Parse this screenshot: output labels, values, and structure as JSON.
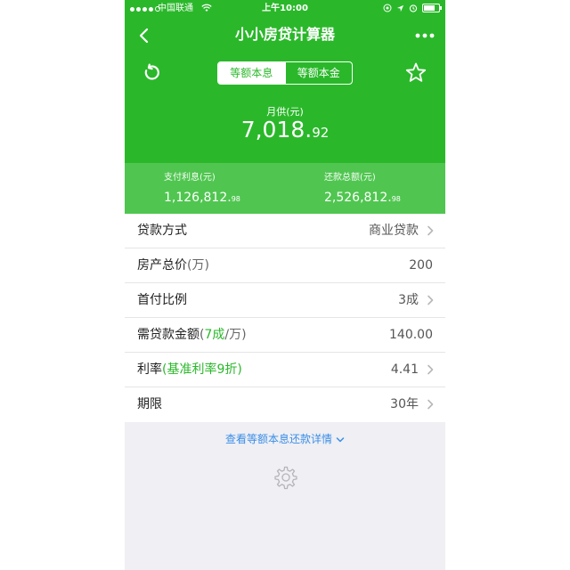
{
  "status_bar": {
    "carrier": "中国联通",
    "time": "上午10:00",
    "battery_level": 0.85
  },
  "nav": {
    "title": "小小房贷计算器"
  },
  "segments": [
    {
      "label": "等额本息",
      "active": true
    },
    {
      "label": "等额本金",
      "active": false
    }
  ],
  "monthly": {
    "label": "月供(元)",
    "value_main": "7,018.",
    "value_small": "92"
  },
  "summary": {
    "interest_label": "支付利息(元)",
    "interest_main": "1,126,812.",
    "interest_small": "98",
    "total_label": "还款总额(元)",
    "total_main": "2,526,812.",
    "total_small": "98"
  },
  "rows": {
    "loan_type": {
      "label": "贷款方式",
      "value": "商业贷款"
    },
    "total_price": {
      "label": "房产总价",
      "unit": "(万)",
      "value": "200"
    },
    "down_payment": {
      "label": "首付比例",
      "value": "3成"
    },
    "loan_amount": {
      "label": "需贷款金额",
      "open": "(",
      "hint": "7成",
      "unit": "/万)",
      "value": "140.00"
    },
    "rate": {
      "label": "利率",
      "hint": "(基准利率9折)",
      "value": "4.41"
    },
    "term": {
      "label": "期限",
      "value": "30年"
    }
  },
  "footer": {
    "details_link": "查看等额本息还款详情"
  },
  "colors": {
    "brand_green": "#2ab82a",
    "summary_green": "#50c650",
    "link_blue": "#3a8ee6"
  },
  "icons": [
    "back-arrow-icon",
    "more-dots-icon",
    "reset-icon",
    "star-icon",
    "chevron-right-icon",
    "chevron-down-icon",
    "gear-icon",
    "wifi-icon",
    "location-arrow-icon",
    "alarm-icon",
    "battery-icon"
  ]
}
